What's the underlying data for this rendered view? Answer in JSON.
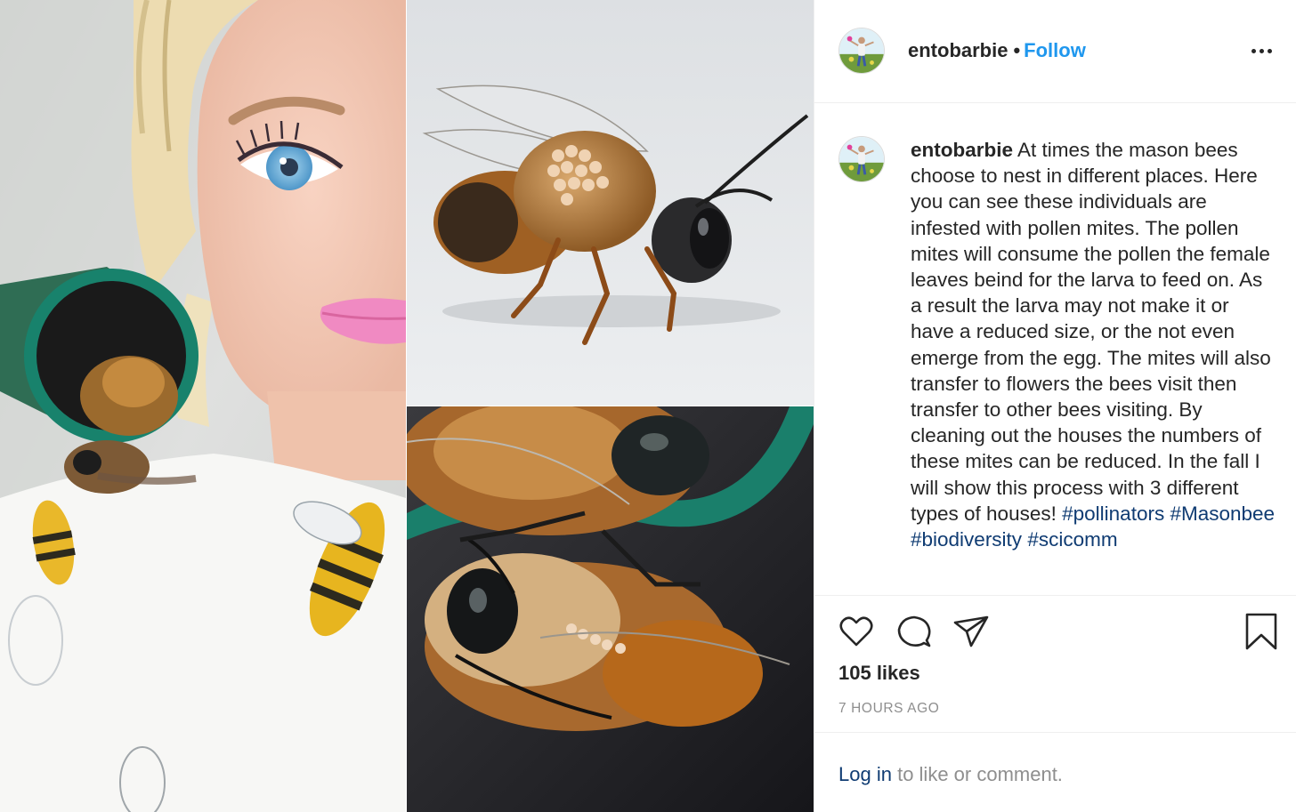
{
  "post": {
    "username": "entobarbie",
    "separator": "•",
    "follow_label": "Follow",
    "more_icon": "more-options-icon",
    "caption_text": "At times the mason bees choose to nest in different places. Here you can see these individuals are infested with pollen mites. The pollen mites will consume the pollen the female leaves beind for the larva to feed on. As a result the larva may not make it or have a reduced size, or the not even emerge from the egg. The mites will also transfer to flowers the bees visit then transfer to other bees visiting. By cleaning out the houses the numbers of these mites can be reduced. In the fall I will show this process with 3 different types of houses!",
    "hashtags": [
      "#pollinators",
      "#Masonbee",
      "#biodiversity",
      "#scicomm"
    ],
    "likes": "105 likes",
    "time_ago": "7 HOURS AGO",
    "login_link": "Log in",
    "login_rest": "to like or comment."
  },
  "icons": {
    "like": "heart-icon",
    "comment": "comment-icon",
    "share": "share-icon",
    "save": "bookmark-icon"
  },
  "colors": {
    "follow": "#1f97ee",
    "hashtag": "#0f3b72",
    "muted": "#8e8e8e",
    "text": "#262626"
  }
}
